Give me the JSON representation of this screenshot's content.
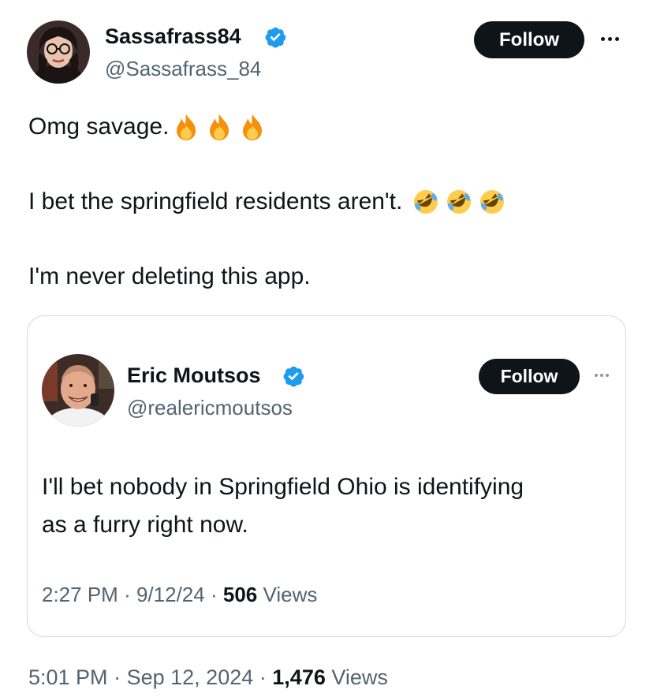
{
  "main_post": {
    "author_name": "Sassafrass84",
    "author_handle": "@Sassafrass_84",
    "follow_label": "Follow",
    "line1": "Omg savage.",
    "line1_emojis": [
      "fire-emoji",
      "fire-emoji",
      "fire-emoji"
    ],
    "line2": "I bet the springfield residents aren't.",
    "line2_emojis": [
      "rolling-on-floor-laughing-emoji",
      "rolling-on-floor-laughing-emoji",
      "rolling-on-floor-laughing-emoji"
    ],
    "line3": "I'm never deleting this app.",
    "time": "5:01 PM",
    "date": "Sep 12, 2024",
    "views_count": "1,476",
    "views_label": "Views"
  },
  "quoted_post": {
    "author_name": "Eric Moutsos",
    "author_handle": "@realericmoutsos",
    "follow_label": "Follow",
    "line1": "I'll bet nobody in Springfield Ohio is identifying",
    "line2": "as a furry right now.",
    "time": "2:27 PM",
    "date": "9/12/24",
    "views_count": "506",
    "views_label": "Views"
  },
  "separator": "·",
  "colors": {
    "verified_blue": "#1d9bf0",
    "text": "#0f1419",
    "muted": "#536471",
    "border": "#cfd9de",
    "button_bg": "#0f1419"
  }
}
